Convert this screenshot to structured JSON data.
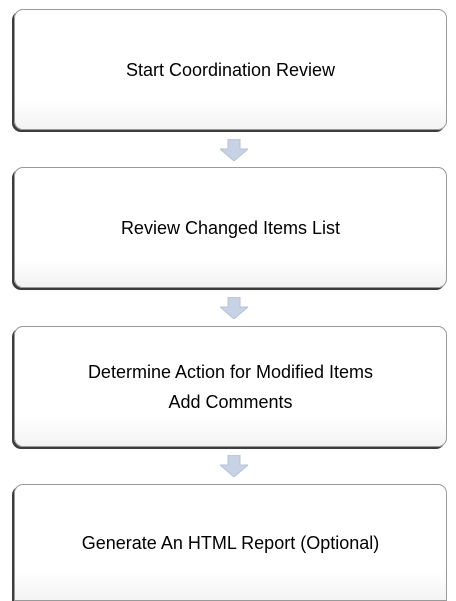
{
  "steps": [
    {
      "lines": [
        "Start Coordination Review"
      ]
    },
    {
      "lines": [
        "Review Changed Items List"
      ]
    },
    {
      "lines": [
        "Determine Action for Modified Items",
        "Add Comments"
      ]
    },
    {
      "lines": [
        "Generate An HTML Report (Optional)"
      ]
    }
  ],
  "colors": {
    "box_border": "#9a9a9a",
    "box_shadow": "#3c3c3c",
    "arrow_fill": "#c7d3e4"
  },
  "icons": {
    "connector": "down-arrow-icon"
  }
}
